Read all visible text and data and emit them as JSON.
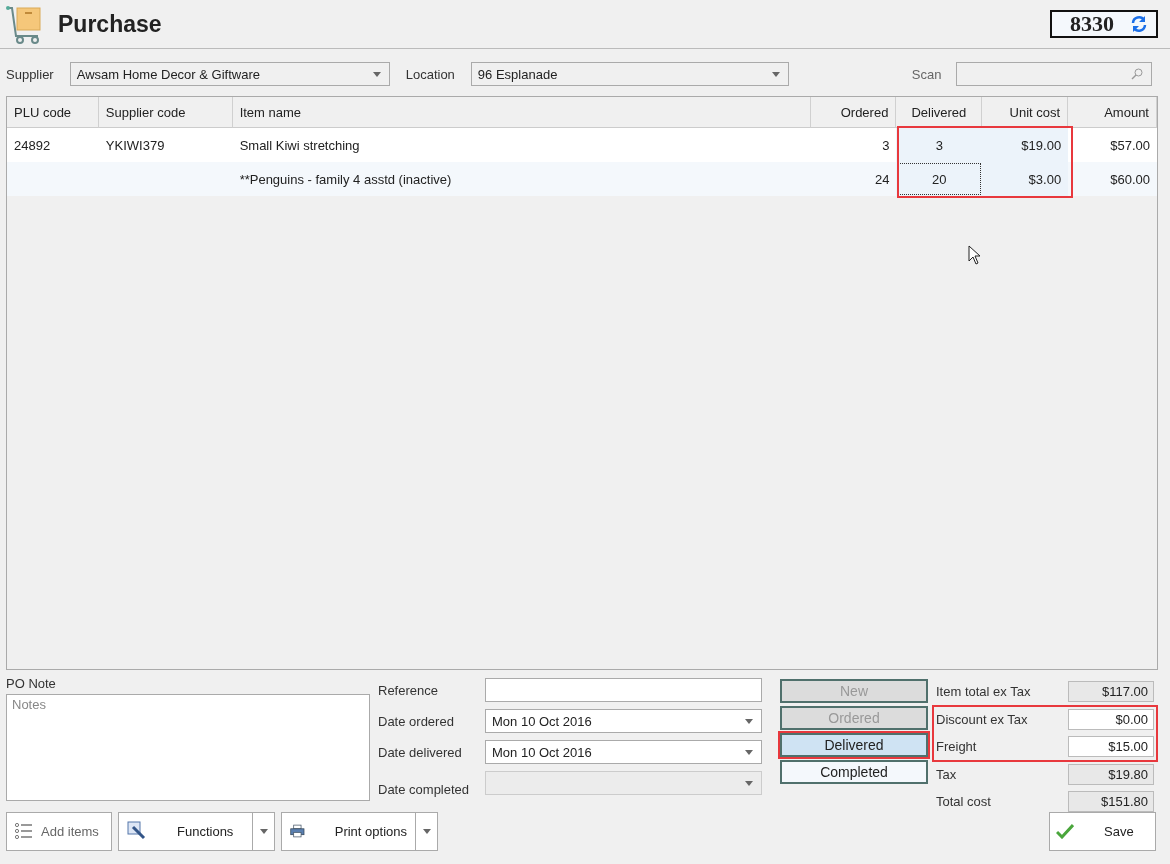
{
  "header": {
    "title": "Purchase",
    "number": "8330"
  },
  "filters": {
    "supplier": {
      "label": "Supplier",
      "value": "Awsam Home Decor & Giftware"
    },
    "location": {
      "label": "Location",
      "value": "96 Esplanade"
    },
    "scan": {
      "label": "Scan"
    }
  },
  "table": {
    "columns": [
      {
        "label": "PLU code",
        "editable": false,
        "highlighted": false
      },
      {
        "label": "Supplier code",
        "editable": false,
        "highlighted": false
      },
      {
        "label": "Item name",
        "editable": false,
        "highlighted": false
      },
      {
        "label": "Ordered",
        "editable": false,
        "highlighted": false
      },
      {
        "label": "Delivered",
        "editable": true,
        "highlighted": true
      },
      {
        "label": "Unit cost",
        "editable": true,
        "highlighted": true
      },
      {
        "label": "Amount",
        "editable": false,
        "highlighted": false
      }
    ],
    "rows": [
      {
        "cells": [
          {
            "text": "24892",
            "focused": false
          },
          {
            "text": "YKIWI379",
            "focused": false
          },
          {
            "text": "Small Kiwi stretching",
            "focused": false
          },
          {
            "text": "3",
            "focused": false
          },
          {
            "text": "3",
            "focused": false
          },
          {
            "text": "$19.00",
            "focused": false
          },
          {
            "text": "$57.00",
            "focused": false
          }
        ]
      },
      {
        "cells": [
          {
            "focused": false
          },
          {
            "focused": false
          },
          {
            "text": "**Penguins - family 4 asstd (inactive)",
            "focused": false
          },
          {
            "text": "24",
            "focused": false
          },
          {
            "text": "20",
            "focused": true
          },
          {
            "text": "$3.00",
            "focused": false
          },
          {
            "text": "$60.00",
            "focused": false
          }
        ]
      }
    ]
  },
  "po_note": {
    "label": "PO Note",
    "placeholder": "Notes"
  },
  "details": [
    {
      "label": "Reference",
      "kind": "text",
      "disabled": false
    },
    {
      "label": "Date ordered",
      "kind": "date",
      "value": "Mon 10 Oct 2016",
      "disabled": false
    },
    {
      "label": "Date delivered",
      "kind": "date",
      "value": "Mon 10 Oct 2016",
      "disabled": false
    },
    {
      "label": "Date completed",
      "kind": "date",
      "disabled": true
    }
  ],
  "statuses": [
    {
      "label": "New",
      "disabled": true,
      "selected": false,
      "highlighted": false
    },
    {
      "label": "Ordered",
      "disabled": true,
      "selected": false,
      "highlighted": false
    },
    {
      "label": "Delivered",
      "disabled": false,
      "selected": true,
      "highlighted": true
    },
    {
      "label": "Completed",
      "disabled": false,
      "selected": false,
      "highlighted": false
    }
  ],
  "totals": [
    {
      "label": "Item total ex Tax",
      "value": "$117.00",
      "editable": false,
      "highlighted": false
    },
    {
      "label": "Discount ex Tax",
      "value": "$0.00",
      "editable": true,
      "highlighted": true
    },
    {
      "label": "Freight",
      "value": "$15.00",
      "editable": true,
      "highlighted": true
    },
    {
      "label": "Tax",
      "value": "$19.80",
      "editable": false,
      "highlighted": false
    },
    {
      "label": "Total cost",
      "value": "$151.80",
      "editable": false,
      "highlighted": false
    }
  ],
  "buttons": [
    {
      "label": "Add items",
      "kind": "list",
      "dropdown": false
    },
    {
      "label": "Functions",
      "kind": "wrench",
      "dropdown": true
    },
    {
      "label": "Print options",
      "kind": "printer",
      "dropdown": true
    }
  ],
  "save": {
    "label": "Save"
  }
}
